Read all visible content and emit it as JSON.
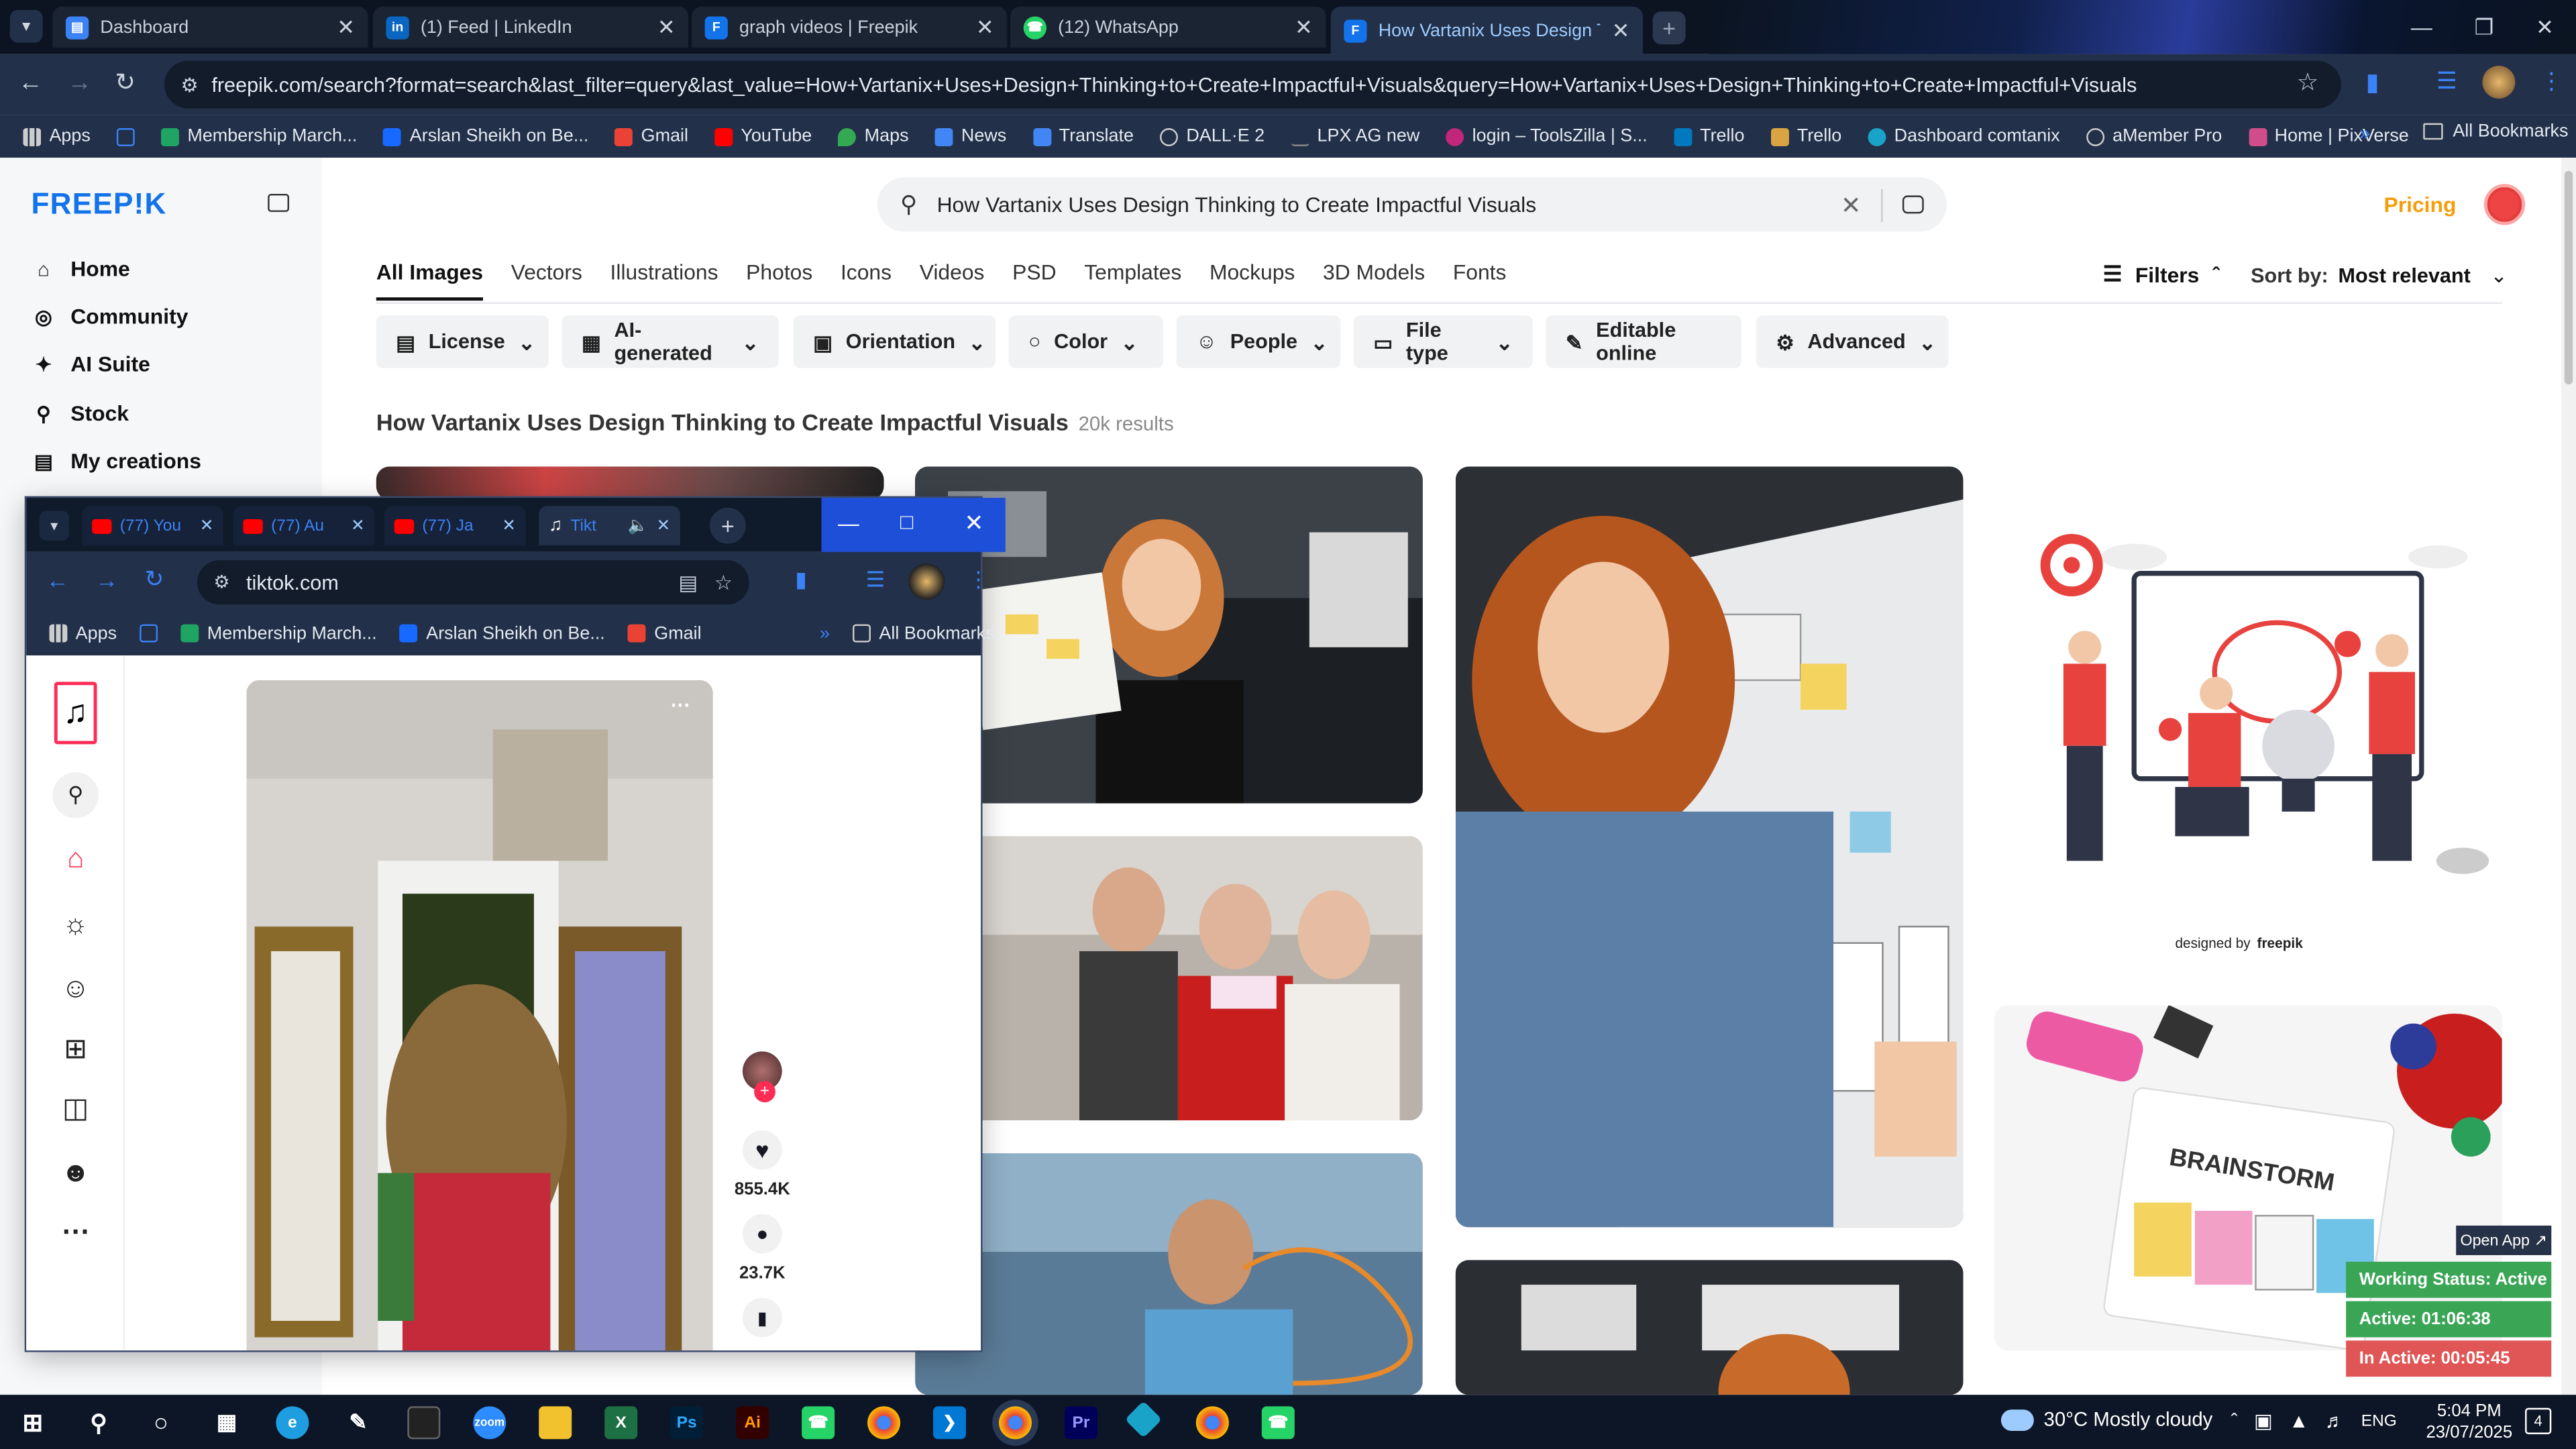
{
  "tabs": [
    {
      "title": "Dashboard",
      "icon": "dashboard-doc-icon"
    },
    {
      "title": "(1) Feed | LinkedIn",
      "icon": "linkedin-icon"
    },
    {
      "title": "graph videos | Freepik",
      "icon": "freepik-icon"
    },
    {
      "title": "(12) WhatsApp",
      "icon": "whatsapp-icon"
    },
    {
      "title": "How Vartanix Uses Design Thinking",
      "icon": "freepik-icon"
    }
  ],
  "url": "freepik.com/search?format=search&last_filter=query&last_value=How+Vartanix+Uses+Design+Thinking+to+Create+Impactful+Visuals&query=How+Vartanix+Uses+Design+Thinking+to+Create+Impactful+Visuals",
  "bookmarks": [
    "Apps",
    "Membership March...",
    "Arslan Sheikh on Be...",
    "Gmail",
    "YouTube",
    "Maps",
    "News",
    "Translate",
    "DALL·E 2",
    "LPX AG new",
    "login – ToolsZilla | S...",
    "Trello",
    "Trello",
    "Dashboard comtanix",
    "aMember Pro",
    "Home | PixVerse"
  ],
  "all_bookmarks": "All Bookmarks",
  "freepik": {
    "logo": "FREEP!K",
    "nav": [
      "Home",
      "Community",
      "AI Suite",
      "Stock",
      "My creations"
    ],
    "search_value": "How Vartanix Uses Design Thinking to Create Impactful Visuals",
    "pricing": "Pricing",
    "categories": [
      "All Images",
      "Vectors",
      "Illustrations",
      "Photos",
      "Icons",
      "Videos",
      "PSD",
      "Templates",
      "Mockups",
      "3D Models",
      "Fonts"
    ],
    "filters_label": "Filters",
    "sort_label": "Sort by:",
    "sort_value": "Most relevant",
    "filter_buttons": [
      "License",
      "AI-generated",
      "Orientation",
      "Color",
      "People",
      "File type",
      "Editable online",
      "Advanced"
    ],
    "results_title": "How Vartanix Uses Design Thinking to Create Impactful Visuals",
    "results_count": "20k results",
    "designed_by": "designed by",
    "designed_brand": "freepik",
    "brainstorm": "BRAINSTORM"
  },
  "popup": {
    "tabs": [
      "(77) You",
      "(77) Au",
      "(77) Ja",
      "Tikt"
    ],
    "url": "tiktok.com",
    "bookmarks": [
      "Apps",
      "Membership March...",
      "Arslan Sheikh on Be...",
      "Gmail"
    ],
    "all_bookmarks": "All Bookmarks",
    "likes": "855.4K",
    "comments": "23.7K"
  },
  "working": {
    "open_app": "Open App ↗",
    "status": "Working Status: Active",
    "active": "Active: 01:06:38",
    "inactive": "In Active: 00:05:45"
  },
  "taskbar": {
    "weather": "30°C  Mostly cloudy",
    "lang": "ENG",
    "time": "5:04 PM",
    "date": "23/07/2025",
    "notif_count": "4"
  },
  "colors": {
    "accent": "#1273eb",
    "pricing": "#f59e0b",
    "active_green": "#3aa655",
    "inactive_red": "#e05555"
  }
}
